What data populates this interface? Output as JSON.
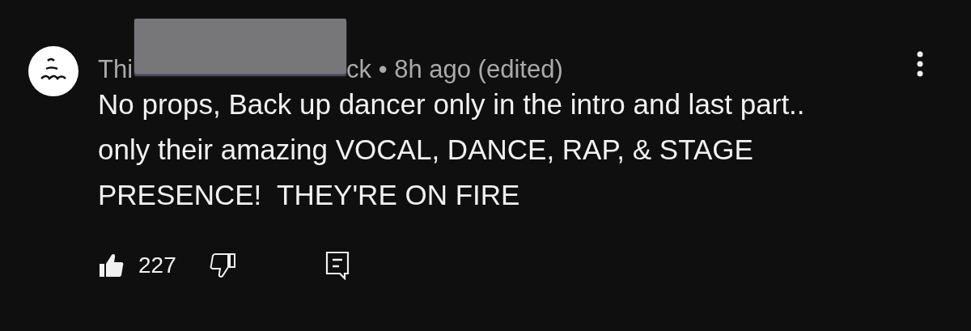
{
  "comment": {
    "author_visible_start": "Thi",
    "author_visible_end": "ck",
    "author_redacted": true,
    "separator": "•",
    "time": "8h ago (edited)",
    "text": "No props, Back up dancer only in the intro and last part.. only their amazing VOCAL, DANCE, RAP, & STAGE PRESENCE!  THEY'RE ON FIRE",
    "likes": "227",
    "liked": true,
    "disliked": false
  }
}
